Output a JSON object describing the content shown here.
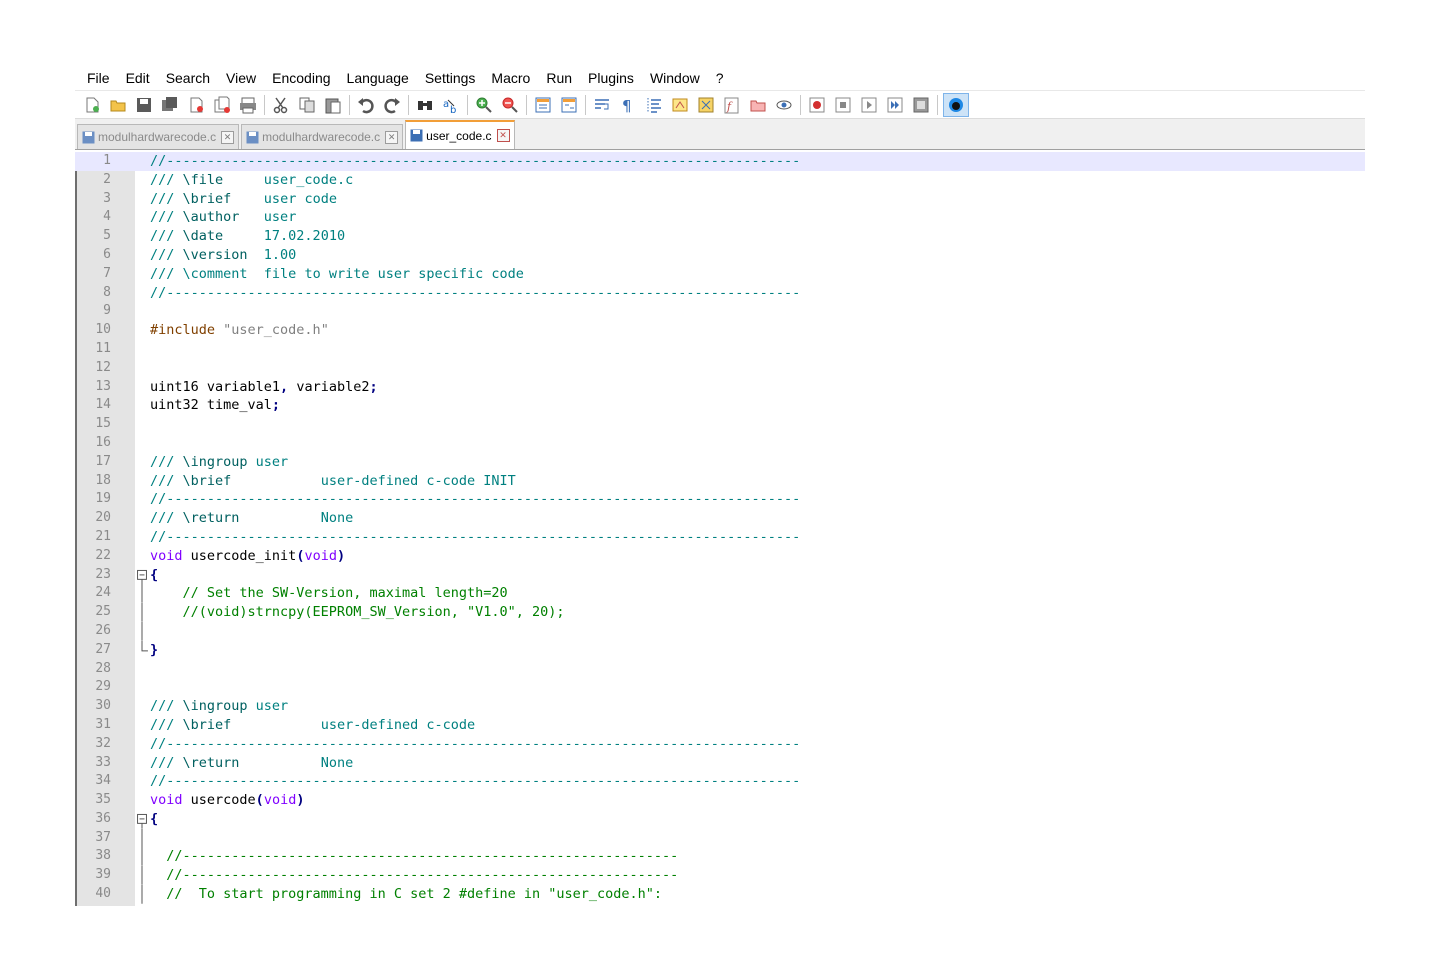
{
  "menu": [
    "File",
    "Edit",
    "Search",
    "View",
    "Encoding",
    "Language",
    "Settings",
    "Macro",
    "Run",
    "Plugins",
    "Window",
    "?"
  ],
  "toolbar": {
    "buttons": [
      "new-file-icon",
      "open-file-icon",
      "save-icon",
      "save-all-icon",
      "close-icon",
      "close-all-icon",
      "print-icon",
      "sep",
      "cut-icon",
      "copy-icon",
      "paste-icon",
      "sep",
      "undo-icon",
      "redo-icon",
      "sep",
      "find-icon",
      "replace-icon",
      "sep",
      "zoom-in-icon",
      "zoom-out-icon",
      "sep",
      "sync-vertical-icon",
      "sync-horizontal-icon",
      "sep",
      "word-wrap-icon",
      "show-all-chars-icon",
      "indent-guide-icon",
      "user-language-icon",
      "document-map-icon",
      "function-list-icon",
      "folder-workspace-icon",
      "monitoring-icon",
      "sep",
      "record-macro-icon",
      "stop-record-icon",
      "play-macro-icon",
      "run-macro-multiple-icon",
      "save-macro-icon",
      "sep",
      "plugin-icon"
    ]
  },
  "tabs": [
    {
      "label": "modulhardwarecode.c",
      "active": false
    },
    {
      "label": "modulhardwarecode.c",
      "active": false
    },
    {
      "label": "user_code.c",
      "active": true
    }
  ],
  "editor": {
    "current_line": 1,
    "lines": [
      {
        "n": "1",
        "segs": [
          [
            "c-doc",
            "//------------------------------------------------------------------------------"
          ]
        ]
      },
      {
        "n": "2",
        "segs": [
          [
            "c-doc",
            "/// "
          ],
          [
            "c-doc-kw",
            "\\file"
          ],
          [
            "c-doc",
            "     user_code.c"
          ]
        ]
      },
      {
        "n": "3",
        "segs": [
          [
            "c-doc",
            "/// "
          ],
          [
            "c-doc-kw",
            "\\brief"
          ],
          [
            "c-doc",
            "    user code"
          ]
        ]
      },
      {
        "n": "4",
        "segs": [
          [
            "c-doc",
            "/// "
          ],
          [
            "c-doc-kw",
            "\\author"
          ],
          [
            "c-doc",
            "   user"
          ]
        ]
      },
      {
        "n": "5",
        "segs": [
          [
            "c-doc",
            "/// "
          ],
          [
            "c-doc-kw",
            "\\date"
          ],
          [
            "c-doc",
            "     17.02.2010"
          ]
        ]
      },
      {
        "n": "6",
        "segs": [
          [
            "c-doc",
            "/// "
          ],
          [
            "c-doc-kw",
            "\\version"
          ],
          [
            "c-doc",
            "  1.00"
          ]
        ]
      },
      {
        "n": "7",
        "segs": [
          [
            "c-doc",
            "/// "
          ],
          [
            "c-doc",
            "\\comment"
          ],
          [
            "c-doc",
            "  file to write user specific code"
          ]
        ]
      },
      {
        "n": "8",
        "segs": [
          [
            "c-doc",
            "//------------------------------------------------------------------------------"
          ]
        ]
      },
      {
        "n": "9",
        "segs": []
      },
      {
        "n": "10",
        "segs": [
          [
            "c-pre",
            "#include "
          ],
          [
            "c-str",
            "\"user_code.h\""
          ]
        ]
      },
      {
        "n": "11",
        "segs": []
      },
      {
        "n": "12",
        "segs": []
      },
      {
        "n": "13",
        "segs": [
          [
            "c-def",
            "uint16 variable1"
          ],
          [
            "c-op",
            ","
          ],
          [
            "c-def",
            " variable2"
          ],
          [
            "c-op",
            ";"
          ]
        ]
      },
      {
        "n": "14",
        "segs": [
          [
            "c-def",
            "uint32 time_val"
          ],
          [
            "c-op",
            ";"
          ]
        ]
      },
      {
        "n": "15",
        "segs": []
      },
      {
        "n": "16",
        "segs": []
      },
      {
        "n": "17",
        "segs": [
          [
            "c-doc",
            "/// "
          ],
          [
            "c-doc-kw",
            "\\ingroup"
          ],
          [
            "c-doc",
            " user"
          ]
        ]
      },
      {
        "n": "18",
        "segs": [
          [
            "c-doc",
            "/// "
          ],
          [
            "c-doc-kw",
            "\\brief"
          ],
          [
            "c-doc",
            "           user-defined c-code INIT"
          ]
        ]
      },
      {
        "n": "19",
        "segs": [
          [
            "c-doc",
            "//------------------------------------------------------------------------------"
          ]
        ]
      },
      {
        "n": "20",
        "segs": [
          [
            "c-doc",
            "/// "
          ],
          [
            "c-doc-kw",
            "\\return"
          ],
          [
            "c-doc",
            "          None"
          ]
        ]
      },
      {
        "n": "21",
        "segs": [
          [
            "c-doc",
            "//------------------------------------------------------------------------------"
          ]
        ]
      },
      {
        "n": "22",
        "segs": [
          [
            "c-type",
            "void"
          ],
          [
            "c-def",
            " usercode_init"
          ],
          [
            "c-op",
            "("
          ],
          [
            "c-type",
            "void"
          ],
          [
            "c-op",
            ")"
          ]
        ]
      },
      {
        "n": "23",
        "fold": "open",
        "segs": [
          [
            "c-op",
            "{"
          ]
        ]
      },
      {
        "n": "24",
        "fold": "mid",
        "segs": [
          [
            "c-comment",
            "    // Set the SW-Version, maximal length=20"
          ]
        ]
      },
      {
        "n": "25",
        "fold": "mid",
        "segs": [
          [
            "c-comment",
            "    //(void)strncpy(EEPROM_SW_Version, \"V1.0\", 20);"
          ]
        ]
      },
      {
        "n": "26",
        "fold": "mid",
        "segs": []
      },
      {
        "n": "27",
        "fold": "end",
        "segs": [
          [
            "c-op",
            "}"
          ]
        ]
      },
      {
        "n": "28",
        "segs": []
      },
      {
        "n": "29",
        "segs": []
      },
      {
        "n": "30",
        "segs": [
          [
            "c-doc",
            "/// "
          ],
          [
            "c-doc-kw",
            "\\ingroup"
          ],
          [
            "c-doc",
            " user"
          ]
        ]
      },
      {
        "n": "31",
        "segs": [
          [
            "c-doc",
            "/// "
          ],
          [
            "c-doc-kw",
            "\\brief"
          ],
          [
            "c-doc",
            "           user-defined c-code"
          ]
        ]
      },
      {
        "n": "32",
        "segs": [
          [
            "c-doc",
            "//------------------------------------------------------------------------------"
          ]
        ]
      },
      {
        "n": "33",
        "segs": [
          [
            "c-doc",
            "/// "
          ],
          [
            "c-doc-kw",
            "\\return"
          ],
          [
            "c-doc",
            "          None"
          ]
        ]
      },
      {
        "n": "34",
        "segs": [
          [
            "c-doc",
            "//------------------------------------------------------------------------------"
          ]
        ]
      },
      {
        "n": "35",
        "segs": [
          [
            "c-type",
            "void"
          ],
          [
            "c-def",
            " usercode"
          ],
          [
            "c-op",
            "("
          ],
          [
            "c-type",
            "void"
          ],
          [
            "c-op",
            ")"
          ]
        ]
      },
      {
        "n": "36",
        "fold": "open",
        "segs": [
          [
            "c-op",
            "{"
          ]
        ]
      },
      {
        "n": "37",
        "fold": "mid",
        "segs": []
      },
      {
        "n": "38",
        "fold": "mid",
        "segs": [
          [
            "c-comment",
            "  //-------------------------------------------------------------"
          ]
        ]
      },
      {
        "n": "39",
        "fold": "mid",
        "segs": [
          [
            "c-comment",
            "  //-------------------------------------------------------------"
          ]
        ]
      },
      {
        "n": "40",
        "fold": "mid",
        "segs": [
          [
            "c-comment",
            "  //  To start programming in C set 2 #define in \"user_code.h\":"
          ]
        ]
      }
    ]
  }
}
